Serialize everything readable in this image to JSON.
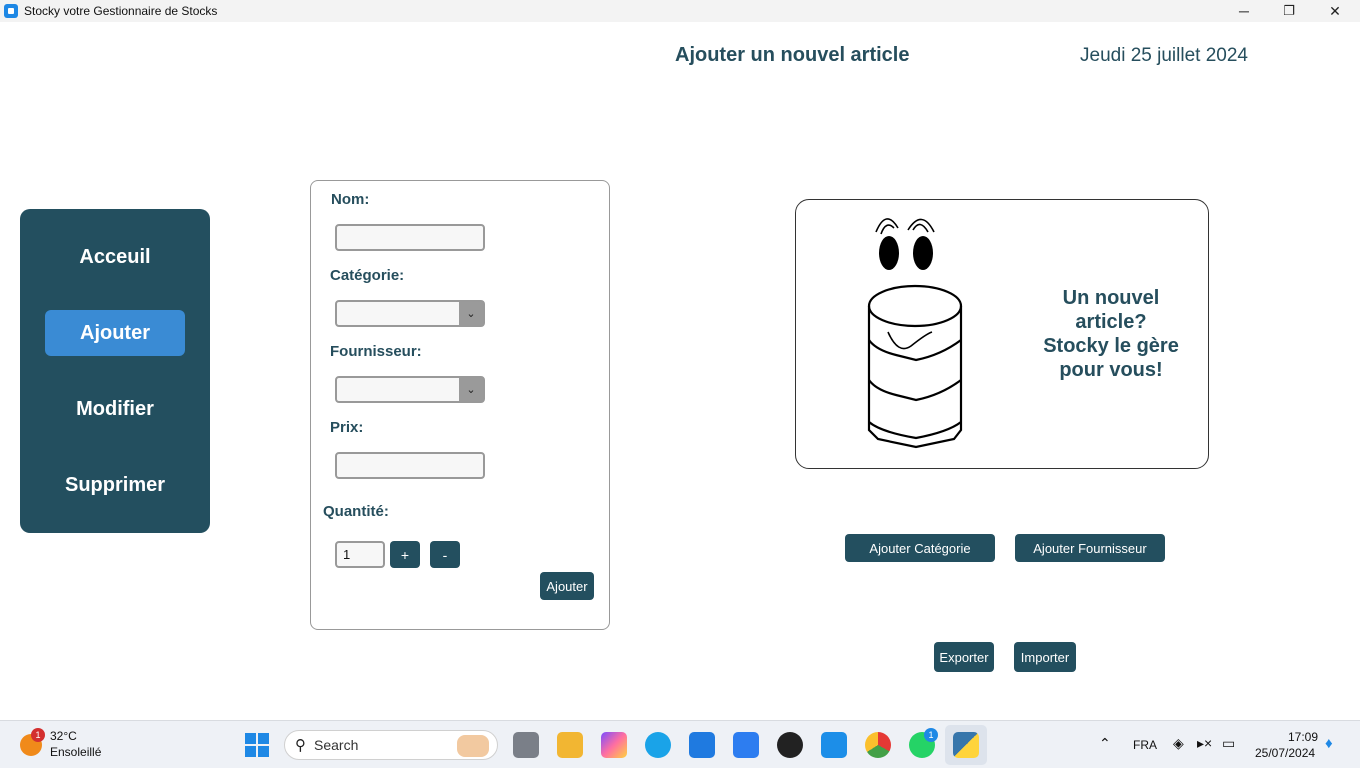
{
  "window": {
    "title": "Stocky votre Gestionnaire de Stocks",
    "controls": {
      "minimize": "─",
      "maximize": "❐",
      "close": "✕"
    }
  },
  "header": {
    "title": "Ajouter un nouvel article",
    "date": "Jeudi 25 juillet 2024"
  },
  "sidebar": {
    "items": [
      {
        "label": "Acceuil",
        "active": false
      },
      {
        "label": "Ajouter",
        "active": true
      },
      {
        "label": "Modifier",
        "active": false
      },
      {
        "label": "Supprimer",
        "active": false
      }
    ]
  },
  "form": {
    "nom_label": "Nom:",
    "nom_value": "",
    "categorie_label": "Catégorie:",
    "categorie_value": "",
    "fournisseur_label": "Fournisseur:",
    "fournisseur_value": "",
    "prix_label": "Prix:",
    "prix_value": "",
    "quantite_label": "Quantité:",
    "quantite_value": "1",
    "plus_label": "+",
    "minus_label": "-",
    "submit_label": "Ajouter",
    "dropdown_icon": "⌄"
  },
  "promo": {
    "text_lines": [
      "Un nouvel",
      "article?",
      "Stocky le gère",
      "pour vous!"
    ]
  },
  "actions": {
    "add_category": "Ajouter Catégorie",
    "add_supplier": "Ajouter Fournisseur",
    "export": "Exporter",
    "import": "Importer"
  },
  "taskbar": {
    "weather_temp": "32°C",
    "weather_desc": "Ensoleillé",
    "weather_badge": "1",
    "search_placeholder": "Search",
    "whatsapp_badge": "1",
    "language": "FRA",
    "time": "17:09",
    "date": "25/07/2024"
  },
  "colors": {
    "primary": "#234f5f",
    "accent": "#3a8bd4",
    "text": "#264e5d"
  }
}
